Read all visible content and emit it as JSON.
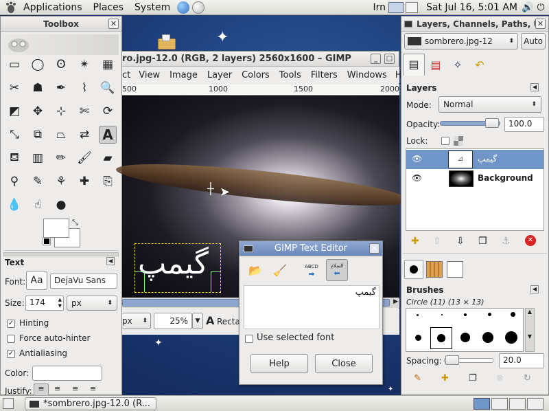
{
  "top_panel": {
    "menus": [
      "Applications",
      "Places",
      "System"
    ],
    "keyboard_layout": "Irn",
    "datetime": "Sat Jul 16,  5:01 AM"
  },
  "toolbox": {
    "title": "Toolbox",
    "tool_options_title": "Text",
    "font_label": "Font:",
    "font_preview": "Aa",
    "font_value": "DejaVu Sans",
    "size_label": "Size:",
    "size_value": "174",
    "size_unit": "px",
    "hinting": "Hinting",
    "force_autohinter": "Force auto-hinter",
    "antialiasing": "Antialiasing",
    "color_label": "Color:",
    "justify_label": "Justify:"
  },
  "image_window": {
    "title": "ro.jpg-12.0 (RGB, 2 layers) 2560x1600 – GIMP",
    "menu": [
      "ct",
      "View",
      "Image",
      "Layer",
      "Colors",
      "Tools",
      "Filters",
      "Windows",
      "He"
    ],
    "ruler": [
      "500",
      "1000",
      "1500",
      "2000"
    ],
    "canvas_text": "گیمپ",
    "unit": "px",
    "zoom": "25%",
    "status": "Recta"
  },
  "text_editor": {
    "title": "GIMP Text Editor",
    "ltr_label": "ABCD",
    "rtl_label": "السلام",
    "content": "گیمپ",
    "use_selected_font": "Use selected font",
    "help": "Help",
    "close": "Close"
  },
  "layers_dock": {
    "title": "Layers, Channels, Paths, U",
    "image_select": "sombrero.jpg-12",
    "auto": "Auto",
    "layers_title": "Layers",
    "mode_label": "Mode:",
    "mode_value": "Normal",
    "opacity_label": "Opacity:",
    "opacity_value": "100.0",
    "lock_label": "Lock:",
    "layers": [
      {
        "name": "گیمپ"
      },
      {
        "name": "Background"
      }
    ],
    "brushes_title": "Brushes",
    "brush_info": "Circle (11) (13 × 13)",
    "spacing_label": "Spacing:",
    "spacing_value": "20.0"
  },
  "taskbar": {
    "task": "*sombrero.jpg-12.0 (R..."
  }
}
